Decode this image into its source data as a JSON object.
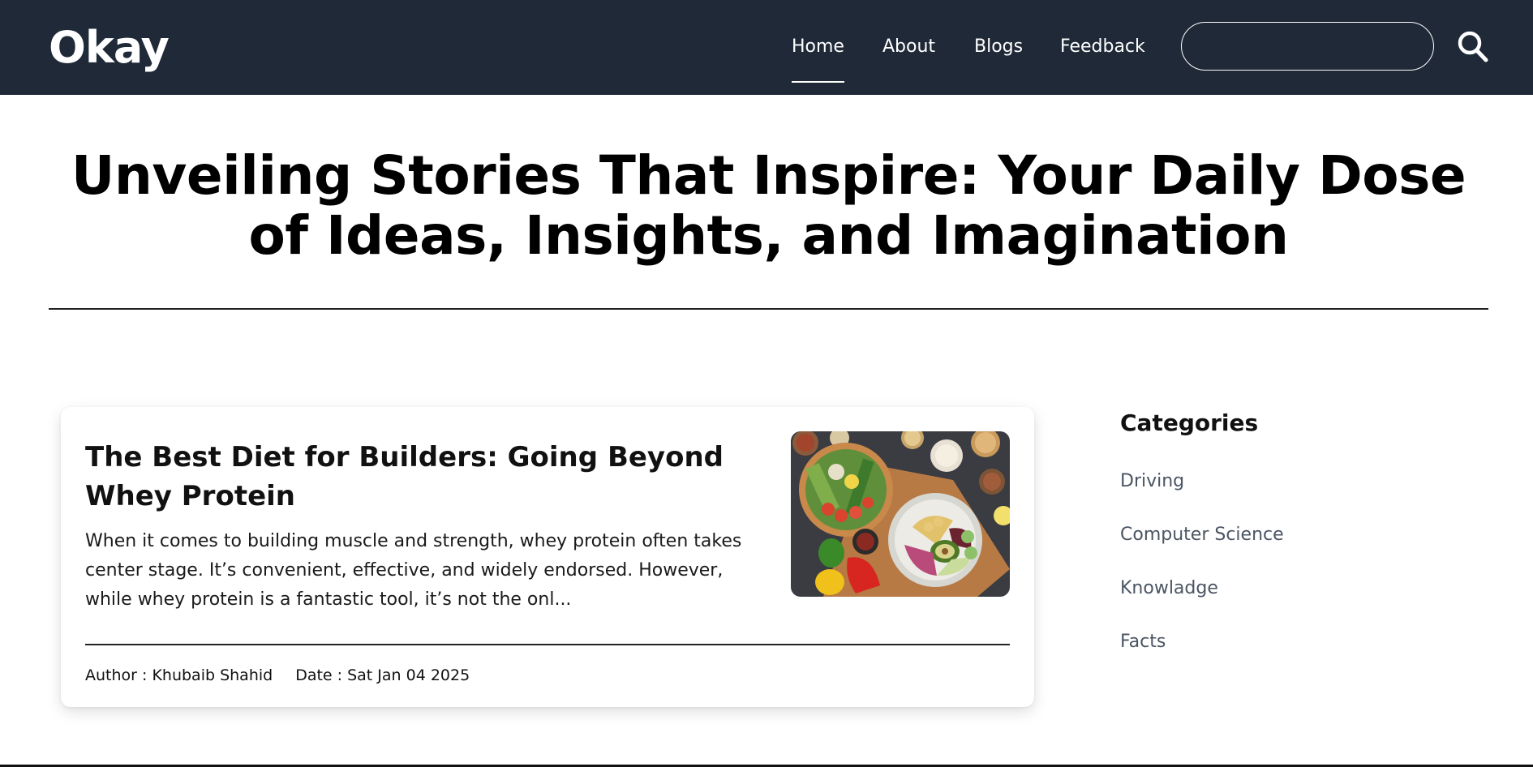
{
  "header": {
    "logo": "Okay",
    "nav": [
      {
        "label": "Home",
        "active": true
      },
      {
        "label": "About",
        "active": false
      },
      {
        "label": "Blogs",
        "active": false
      },
      {
        "label": "Feedback",
        "active": false
      }
    ],
    "search": {
      "value": "",
      "placeholder": "",
      "icon": "search-icon"
    },
    "colors": {
      "background": "#1f2937",
      "text": "#ffffff"
    }
  },
  "hero": {
    "title": "Unveiling Stories That Inspire: Your Daily Dose of Ideas, Insights, and Imagination"
  },
  "posts": [
    {
      "title": "The Best Diet for Builders: Going Beyond Whey Protein",
      "excerpt": "When it comes to building muscle and strength, whey protein often takes center stage. It’s convenient, effective, and widely endorsed. However, while whey protein is a fantastic tool, it’s not the onl...",
      "author": "Author : Khubaib Shahid",
      "date": "Date : Sat Jan 04 2025",
      "image": "healthy-food-bowls-photo"
    }
  ],
  "sidebar": {
    "title": "Categories",
    "categories": [
      "Driving",
      "Computer Science",
      "Knowladge",
      "Facts"
    ],
    "link_color": "#4b5563"
  }
}
